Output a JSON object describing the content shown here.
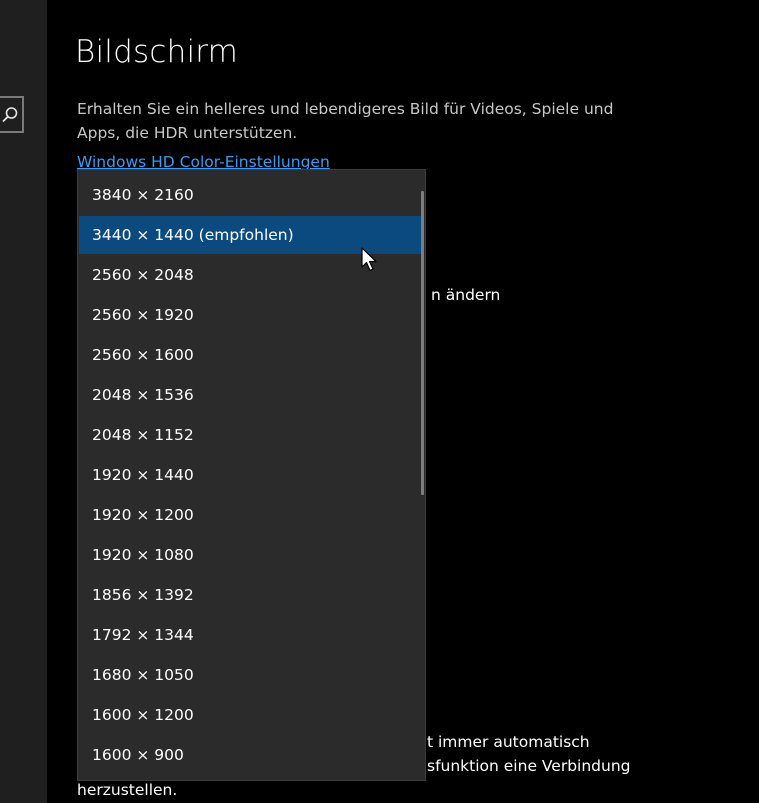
{
  "page": {
    "title": "Bildschirm",
    "hdr_description": "Erhalten Sie ein helleres und lebendigeres Bild für Videos, Spiele und Apps, die HDR unterstützen.",
    "hdr_link": "Windows HD Color-Einstellungen",
    "partial_text_change": "n ändern",
    "bottom_text": {
      "line1": "t immer automatisch",
      "line2": "sfunktion eine Verbindung",
      "line3": "herzustellen."
    }
  },
  "sidebar": {
    "search_icon": "search-icon"
  },
  "resolution_dropdown": {
    "selected": "3440 × 1440 (empfohlen)",
    "options": [
      "3840 × 2160",
      "3440 × 1440 (empfohlen)",
      "2560 × 2048",
      "2560 × 1920",
      "2560 × 1600",
      "2048 × 1536",
      "2048 × 1152",
      "1920 × 1440",
      "1920 × 1200",
      "1920 × 1080",
      "1856 × 1392",
      "1792 × 1344",
      "1680 × 1050",
      "1600 × 1200",
      "1600 × 900"
    ]
  },
  "colors": {
    "background": "#000000",
    "sidebar": "#1f1f1f",
    "dropdown_bg": "#2b2b2b",
    "selected_item": "#0b4a7f",
    "link": "#3a9cf0"
  }
}
